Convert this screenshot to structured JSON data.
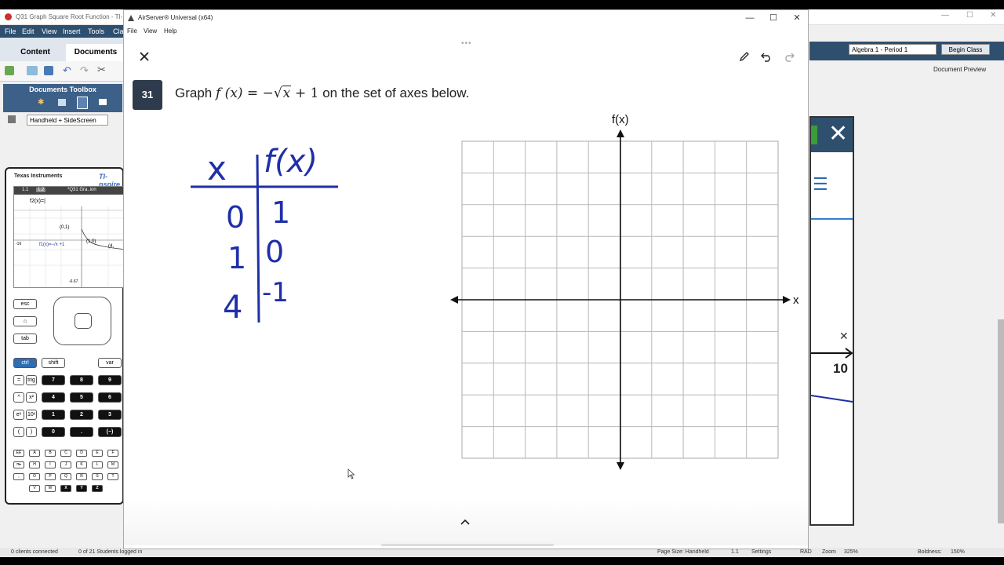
{
  "background_app": {
    "window_title": "Q31 Graph Square Root Function - TI-N",
    "menu": [
      "File",
      "Edit",
      "View",
      "Insert",
      "Tools",
      "Cla"
    ],
    "tabs": [
      "Content",
      "Documents"
    ],
    "toolbox_title": "Documents Toolbox",
    "handheld_select": "Handheld + SideScreen",
    "device_brand": "Texas Instruments",
    "device_model": "TI-nspire",
    "screen_tabs": [
      "1.1",
      "1.2",
      "*Q31 Gra..ion"
    ],
    "screen_labels": {
      "f2": "f2(x)=|",
      "f1": "f1(x)=-√x +1",
      "p1": "(0,1)",
      "p2": "(1,0)",
      "p3": "(4,",
      "ymin": "-6.67",
      "xmin": "-16"
    },
    "keys_row_top": [
      "esc",
      "tab"
    ],
    "keys_ctrl": [
      "ctrl",
      "shift",
      "var"
    ],
    "keys_num": [
      [
        "=",
        "trig",
        "7",
        "8",
        "9"
      ],
      [
        "^",
        "x²",
        "4",
        "5",
        "6"
      ],
      [
        "eˣ",
        "10ˣ",
        "1",
        "2",
        "3"
      ],
      [
        "(",
        ")",
        "0",
        ".",
        "(−)"
      ]
    ],
    "keys_alpha": [
      [
        "EE",
        "A",
        "B",
        "C",
        "D",
        "E",
        "F"
      ],
      [
        "π▸",
        "H",
        "I",
        "J",
        "K",
        "L",
        "M"
      ],
      [
        ",",
        "O",
        "P",
        "Q",
        "R",
        "S",
        "T"
      ],
      [
        "V",
        "W",
        "X",
        "Y",
        "Z"
      ]
    ],
    "class_select": "Algebra 1 - Period 1",
    "begin_class": "Begin Class",
    "doc_preview": "Document Preview",
    "side_label": "10",
    "status_left": "0 clients connected",
    "status_students": "0 of 21 Students logged in",
    "status_right": [
      "Page Size: Handheld",
      "1.1",
      "Settings",
      "RAD",
      "Zoom",
      "325%",
      "Boldness:",
      "150%"
    ]
  },
  "airserver": {
    "title": "AirServer® Universal (x64)",
    "menu": [
      "File",
      "View",
      "Help"
    ],
    "window_controls": [
      "—",
      "☐",
      "✕"
    ]
  },
  "question": {
    "number": "31",
    "prompt_before": "Graph",
    "function_text": "f (x) = −",
    "radicand": "x",
    "function_tail": "+ 1",
    "prompt_after": "on the set of axes below."
  },
  "table": {
    "headers": [
      "x",
      "f(x)"
    ],
    "rows": [
      [
        "0",
        "1"
      ],
      [
        "1",
        "0"
      ],
      [
        "4",
        "-1"
      ]
    ]
  },
  "grid": {
    "y_axis_label": "f(x)",
    "x_axis_label": "x",
    "columns": 10,
    "rows": 10
  },
  "colors": {
    "handwriting": "#1f2fa8",
    "question_badge": "#2e3b4c",
    "nspire_blue": "#2f6db3",
    "grid_line": "#b8b8b8"
  }
}
